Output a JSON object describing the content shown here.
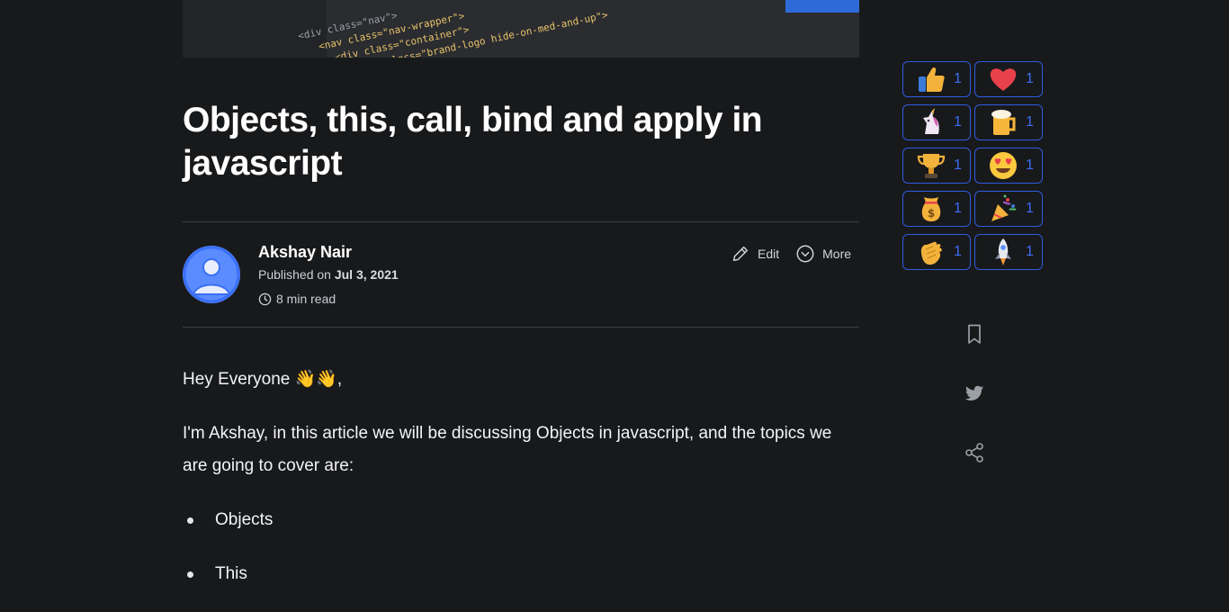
{
  "cover": {
    "code_lines": [
      "<div class=\"nav\">",
      "<nav class=\"nav-wrapper\">",
      "<div class=\"container\">",
      "<a class=\"brand-logo hide-on-med-and-up\">"
    ]
  },
  "article": {
    "title": "Objects, this, call, bind and apply in javascript",
    "author": {
      "name": "Akshay Nair",
      "published_prefix": "Published on",
      "published_date": "Jul 3, 2021",
      "read_time": "8 min read"
    },
    "actions": {
      "edit": "Edit",
      "more": "More"
    },
    "greeting": "Hey Everyone 👋👋,",
    "intro": "I'm Akshay, in this article we will be discussing Objects in javascript, and the topics we are going to cover are:",
    "topics": [
      "Objects",
      "This"
    ]
  },
  "reactions": [
    {
      "icon": "thumbs-up-icon",
      "count": "1"
    },
    {
      "icon": "heart-icon",
      "count": "1"
    },
    {
      "icon": "unicorn-icon",
      "count": "1"
    },
    {
      "icon": "beer-icon",
      "count": "1"
    },
    {
      "icon": "trophy-icon",
      "count": "1"
    },
    {
      "icon": "heart-eyes-icon",
      "count": "1"
    },
    {
      "icon": "money-bag-icon",
      "count": "1"
    },
    {
      "icon": "party-popper-icon",
      "count": "1"
    },
    {
      "icon": "clapping-hands-icon",
      "count": "1"
    },
    {
      "icon": "rocket-icon",
      "count": "1"
    }
  ],
  "sidebar_actions": [
    "bookmark-icon",
    "twitter-icon",
    "share-icon"
  ],
  "colors": {
    "background": "#18191b",
    "accent": "#2f5be0",
    "count": "#3b6ef5"
  }
}
